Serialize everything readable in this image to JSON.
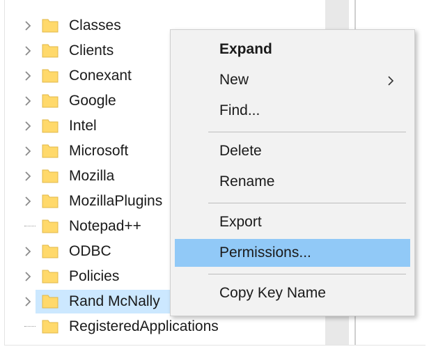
{
  "tree": {
    "items": [
      {
        "label": "Classes",
        "expander": "chevron-right"
      },
      {
        "label": "Clients",
        "expander": "chevron-right"
      },
      {
        "label": "Conexant",
        "expander": "chevron-right"
      },
      {
        "label": "Google",
        "expander": "chevron-right"
      },
      {
        "label": "Intel",
        "expander": "chevron-right"
      },
      {
        "label": "Microsoft",
        "expander": "chevron-right"
      },
      {
        "label": "Mozilla",
        "expander": "chevron-right"
      },
      {
        "label": "MozillaPlugins",
        "expander": "chevron-right"
      },
      {
        "label": "Notepad++",
        "expander": "none"
      },
      {
        "label": "ODBC",
        "expander": "chevron-right"
      },
      {
        "label": "Policies",
        "expander": "chevron-right"
      },
      {
        "label": "Rand McNally",
        "expander": "chevron-right",
        "selected": true
      },
      {
        "label": "RegisteredApplications",
        "expander": "none"
      }
    ]
  },
  "context_menu": {
    "items": [
      {
        "label": "Expand",
        "bold": true
      },
      {
        "label": "New",
        "submenu": true
      },
      {
        "label": "Find..."
      },
      {
        "separator": true
      },
      {
        "label": "Delete"
      },
      {
        "label": "Rename"
      },
      {
        "separator": true
      },
      {
        "label": "Export"
      },
      {
        "label": "Permissions...",
        "highlighted": true
      },
      {
        "separator": true
      },
      {
        "label": "Copy Key Name"
      }
    ]
  },
  "colors": {
    "selection": "#cce8ff",
    "menu_highlight": "#91c9f7",
    "menu_background": "#f2f2f2",
    "folder": "#ffd96b"
  },
  "icons": {
    "folder": "folder-icon",
    "expander": "chevron-right-icon",
    "submenu": "chevron-right-icon"
  }
}
